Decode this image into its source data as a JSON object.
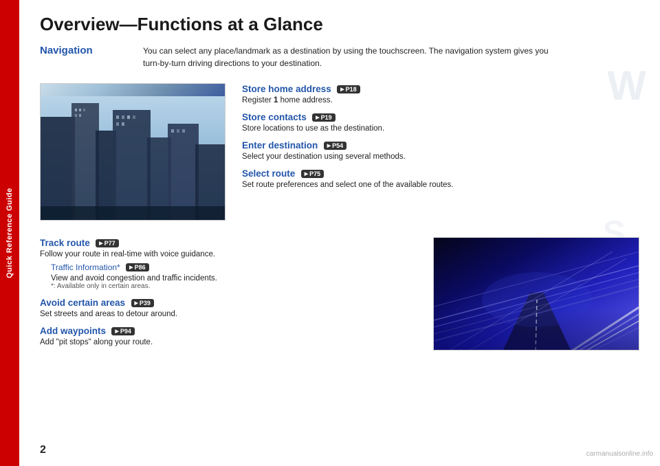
{
  "sidebar": {
    "label": "Quick Reference Guide"
  },
  "page": {
    "title": "Overview—Functions at a Glance",
    "number": "2",
    "watermark": "carmanualsonline.info"
  },
  "navigation": {
    "label": "Navigation",
    "description_line1": "You can select any place/landmark as a destination by using the touchscreen. The navigation system gives you",
    "description_line2": "turn-by-turn driving directions to your destination."
  },
  "features": [
    {
      "title": "Store home address",
      "badge": "P18",
      "description": "Register 1 home address."
    },
    {
      "title": "Store contacts",
      "badge": "P19",
      "description": "Store locations to use as the destination."
    },
    {
      "title": "Enter destination",
      "badge": "P54",
      "description": "Select your destination using several methods."
    },
    {
      "title": "Select route",
      "badge": "P75",
      "description": "Set route preferences and select one of the available routes."
    }
  ],
  "lower_features": [
    {
      "title": "Track route",
      "badge": "P77",
      "description": "Follow your route in real-time with voice guidance.",
      "sub": {
        "title": "Traffic Information*",
        "badge": "P86",
        "description": "View and avoid congestion and traffic incidents.",
        "note": "*: Available only in certain areas."
      }
    },
    {
      "title": "Avoid certain areas",
      "badge": "P39",
      "description": "Set streets and areas to detour around."
    },
    {
      "title": "Add waypoints",
      "badge": "P94",
      "description": "Add “pit stops” along your route."
    }
  ],
  "compass": {
    "w_letter": "W",
    "s_letter": "S"
  }
}
